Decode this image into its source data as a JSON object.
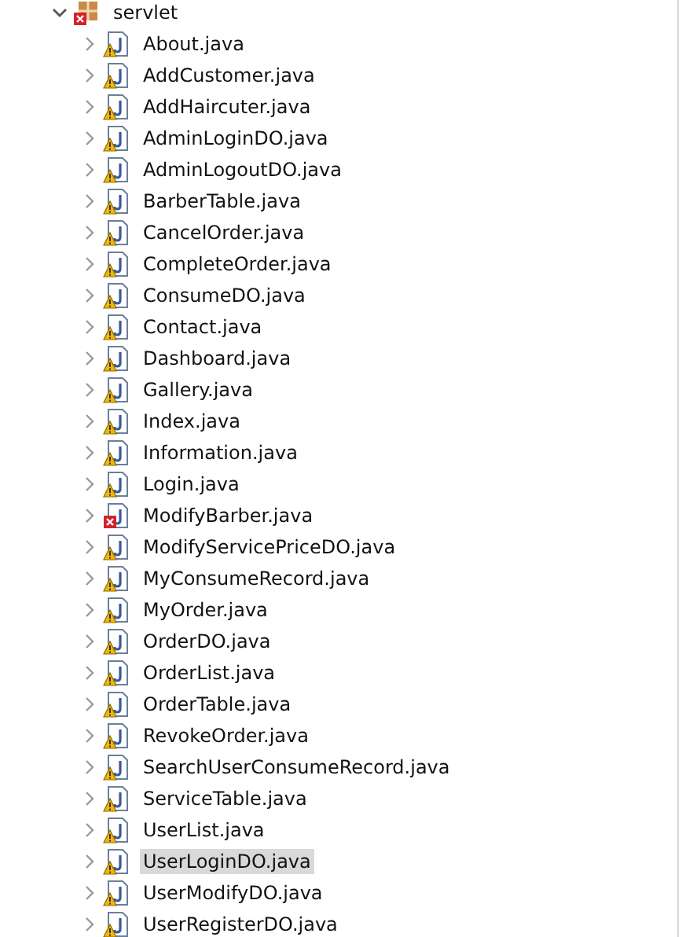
{
  "tree": {
    "label": "servlet",
    "expanded": true,
    "kind": "error",
    "children": [
      {
        "label": "About.java",
        "kind": "warning",
        "expanded": false,
        "selected": false
      },
      {
        "label": "AddCustomer.java",
        "kind": "warning",
        "expanded": false,
        "selected": false
      },
      {
        "label": "AddHaircuter.java",
        "kind": "warning",
        "expanded": false,
        "selected": false
      },
      {
        "label": "AdminLoginDO.java",
        "kind": "warning",
        "expanded": false,
        "selected": false
      },
      {
        "label": "AdminLogoutDO.java",
        "kind": "warning",
        "expanded": false,
        "selected": false
      },
      {
        "label": "BarberTable.java",
        "kind": "warning",
        "expanded": false,
        "selected": false
      },
      {
        "label": "CancelOrder.java",
        "kind": "warning",
        "expanded": false,
        "selected": false
      },
      {
        "label": "CompleteOrder.java",
        "kind": "warning",
        "expanded": false,
        "selected": false
      },
      {
        "label": "ConsumeDO.java",
        "kind": "warning",
        "expanded": false,
        "selected": false
      },
      {
        "label": "Contact.java",
        "kind": "warning",
        "expanded": false,
        "selected": false
      },
      {
        "label": "Dashboard.java",
        "kind": "warning",
        "expanded": false,
        "selected": false
      },
      {
        "label": "Gallery.java",
        "kind": "warning",
        "expanded": false,
        "selected": false
      },
      {
        "label": "Index.java",
        "kind": "warning",
        "expanded": false,
        "selected": false
      },
      {
        "label": "Information.java",
        "kind": "warning",
        "expanded": false,
        "selected": false
      },
      {
        "label": "Login.java",
        "kind": "warning",
        "expanded": false,
        "selected": false
      },
      {
        "label": "ModifyBarber.java",
        "kind": "error",
        "expanded": false,
        "selected": false
      },
      {
        "label": "ModifyServicePriceDO.java",
        "kind": "warning",
        "expanded": false,
        "selected": false
      },
      {
        "label": "MyConsumeRecord.java",
        "kind": "warning",
        "expanded": false,
        "selected": false
      },
      {
        "label": "MyOrder.java",
        "kind": "warning",
        "expanded": false,
        "selected": false
      },
      {
        "label": "OrderDO.java",
        "kind": "warning",
        "expanded": false,
        "selected": false
      },
      {
        "label": "OrderList.java",
        "kind": "warning",
        "expanded": false,
        "selected": false
      },
      {
        "label": "OrderTable.java",
        "kind": "warning",
        "expanded": false,
        "selected": false
      },
      {
        "label": "RevokeOrder.java",
        "kind": "warning",
        "expanded": false,
        "selected": false
      },
      {
        "label": "SearchUserConsumeRecord.java",
        "kind": "warning",
        "expanded": false,
        "selected": false
      },
      {
        "label": "ServiceTable.java",
        "kind": "warning",
        "expanded": false,
        "selected": false
      },
      {
        "label": "UserList.java",
        "kind": "warning",
        "expanded": false,
        "selected": false
      },
      {
        "label": "UserLoginDO.java",
        "kind": "warning",
        "expanded": false,
        "selected": true
      },
      {
        "label": "UserModifyDO.java",
        "kind": "warning",
        "expanded": false,
        "selected": false
      },
      {
        "label": "UserRegisterDO.java",
        "kind": "warning",
        "expanded": false,
        "selected": false
      }
    ]
  }
}
